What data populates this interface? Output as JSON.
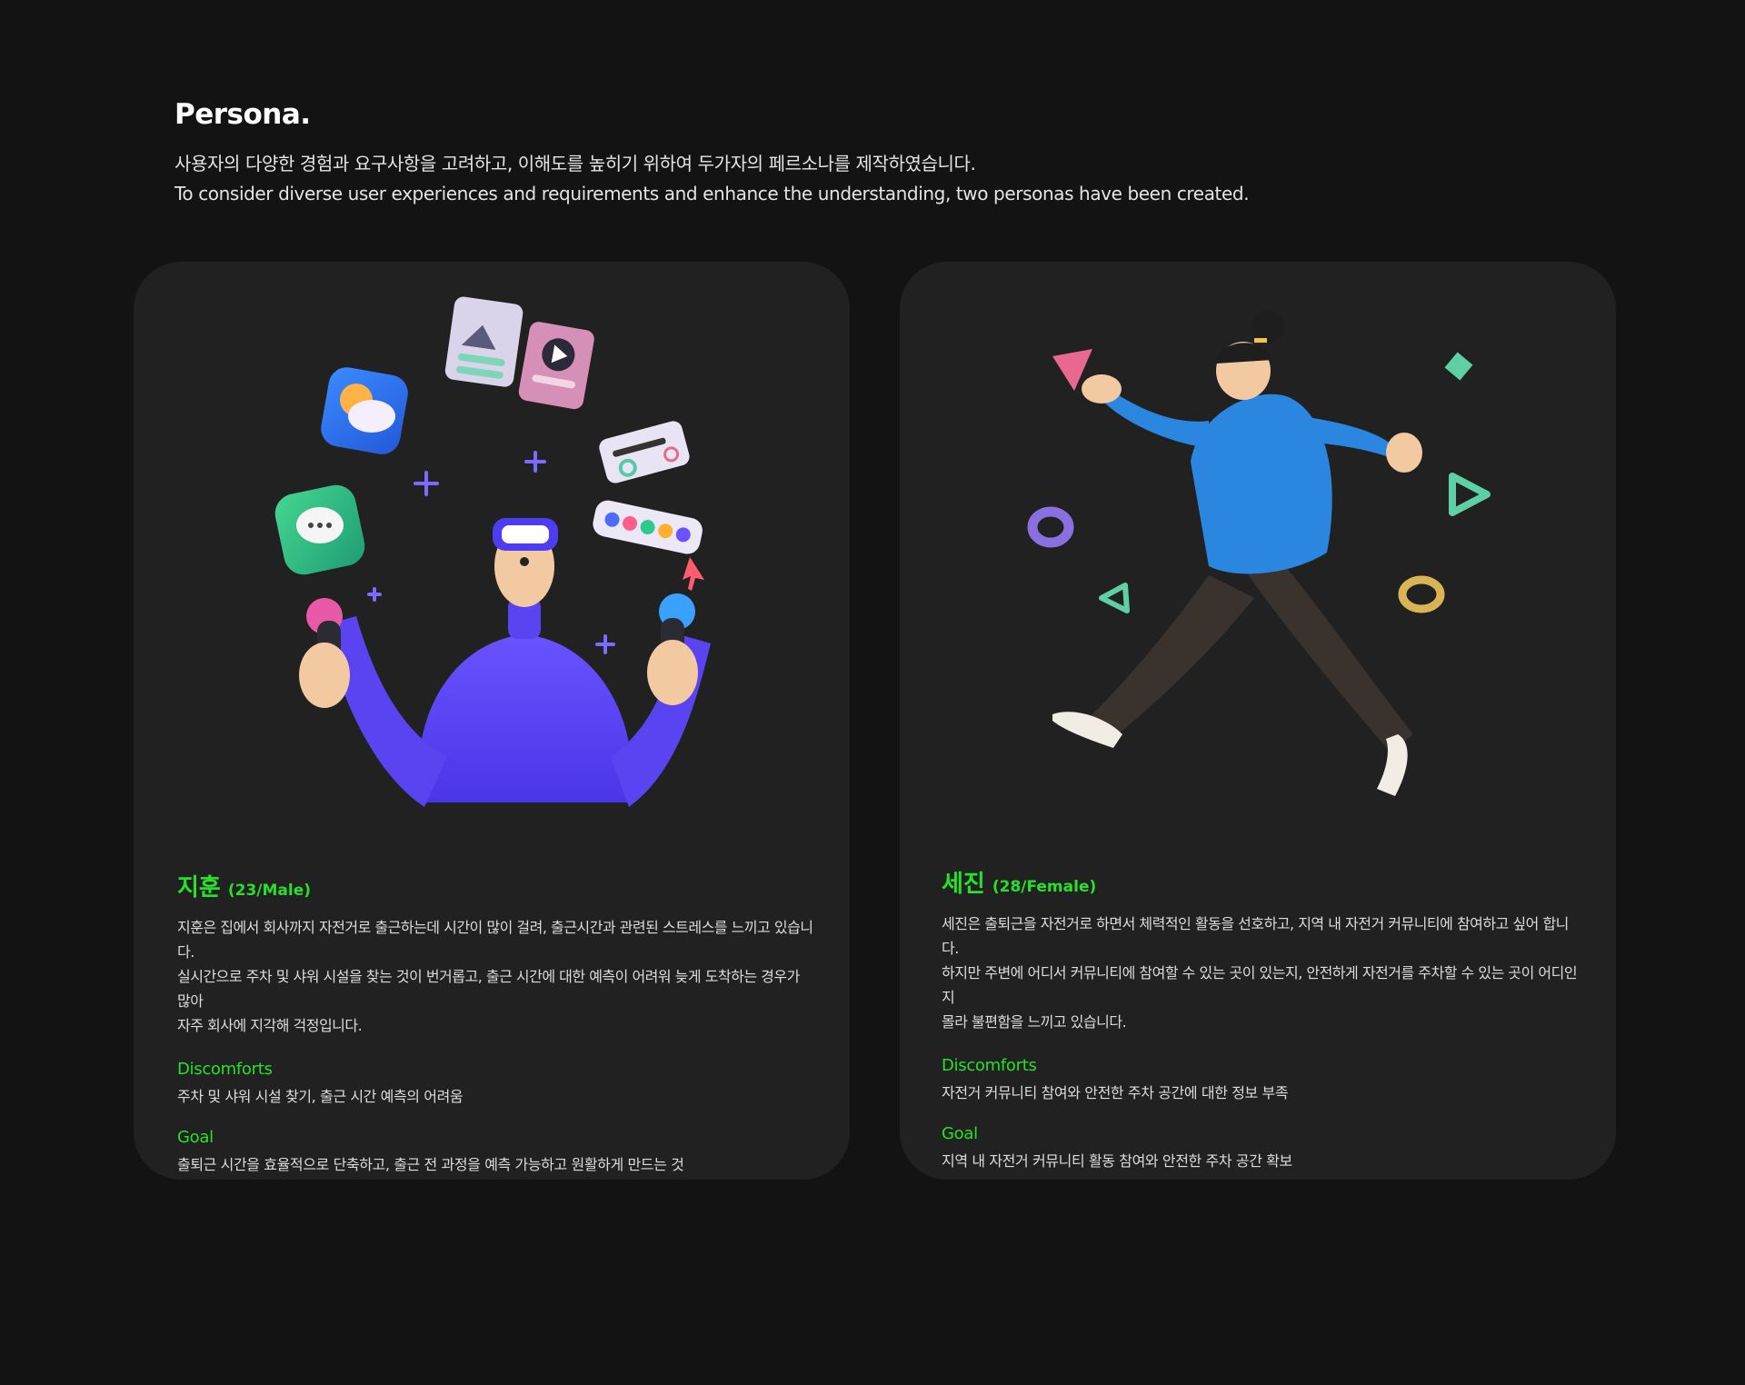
{
  "header": {
    "title": "Persona.",
    "description_ko": "사용자의 다양한 경험과 요구사항을 고려하고, 이해도를 높히기 위하여 두가자의 페르소나를 제작하였습니다.",
    "description_en": "To consider diverse user experiences and requirements and enhance the understanding, two personas have been created."
  },
  "personas": [
    {
      "name": "지훈",
      "meta": "(23/Male)",
      "description": "지훈은 집에서 회사까지 자전거로 출근하는데 시간이 많이 걸려, 출근시간과 관련된 스트레스를  느끼고 있습니다.\n실시간으로 주차 및 샤워 시설을 찾는 것이 번거롭고, 출근 시간에 대한 예측이 어려워 늦게 도착하는 경우가 많아\n자주 회사에 지각해 걱정입니다.",
      "discomforts_title": "Discomforts",
      "discomforts": "주차 및 샤워 시설 찾기, 출근 시간 예측의 어려움",
      "goal_title": "Goal",
      "goal": "출퇴근 시간을 효율적으로 단축하고, 출근 전 과정을 예측 가능하고 원활하게 만드는 것",
      "illustration": "vr-man-illustration"
    },
    {
      "name": "세진",
      "meta": "(28/Female)",
      "description": "세진은 출퇴근을 자전거로 하면서 체력적인 활동을 선호하고, 지역 내 자전거 커뮤니티에 참여하고 싶어 합니다.\n하지만 주변에 어디서 커뮤니티에 참여할 수 있는 곳이 있는지, 안전하게 자전거를 주차할 수 있는 곳이 어디인지\n몰라 불편함을 느끼고 있습니다.",
      "discomforts_title": "Discomforts",
      "discomforts": "자전거 커뮤니티 참여와 안전한 주차 공간에 대한 정보 부족",
      "goal_title": "Goal",
      "goal": "지역 내 자전거 커뮤니티 활동 참여와 안전한 주차 공간 확보",
      "illustration": "walking-woman-illustration"
    }
  ],
  "colors": {
    "background": "#131313",
    "card": "#212121",
    "accent_green": "#27e02a"
  }
}
